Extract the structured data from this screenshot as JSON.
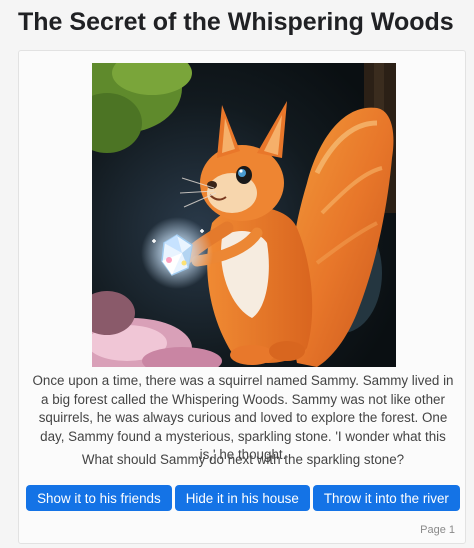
{
  "story": {
    "title": "The Secret of the Whispering Woods",
    "image_description": "Painted illustration of an orange squirrel holding a sparkling crystal stone in a forest",
    "text": "Once upon a time, there was a squirrel named Sammy. Sammy lived in a big forest called the Whispering Woods. Sammy was not like other squirrels, he was always curious and loved to explore the forest. One day, Sammy found a mysterious, sparkling stone. 'I wonder what this is,' he thought.",
    "question": "What should Sammy do next with the sparkling stone?",
    "choices": [
      {
        "label": "Show it to his friends"
      },
      {
        "label": "Hide it in his house"
      },
      {
        "label": "Throw it into the river"
      }
    ],
    "page_label": "Page 1"
  },
  "colors": {
    "button": "#1473e6",
    "button_text": "#ffffff",
    "background": "#f5f5f5",
    "card": "#fbfbfb"
  }
}
